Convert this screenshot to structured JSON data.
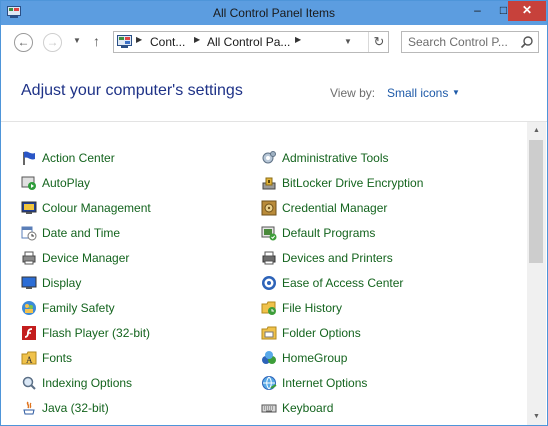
{
  "window": {
    "title": "All Control Panel Items",
    "minimize": "–",
    "maximize": "□",
    "close": "✕"
  },
  "nav": {
    "back": "←",
    "forward": "→",
    "recent": "▼",
    "up": "↑"
  },
  "address": {
    "crumbs": [
      "Cont...",
      "All Control Pa..."
    ],
    "separator": "▶",
    "dropdown": "▼",
    "refresh": "↻"
  },
  "search": {
    "placeholder": "Search Control P..."
  },
  "header": {
    "title": "Adjust your computer's settings",
    "view_by_label": "View by:",
    "view_by_value": "Small icons",
    "view_by_arrow": "▼"
  },
  "items_left": [
    {
      "label": "Action Center",
      "icon": "flag-icon"
    },
    {
      "label": "AutoPlay",
      "icon": "autoplay-icon"
    },
    {
      "label": "Colour Management",
      "icon": "monitor-icon"
    },
    {
      "label": "Date and Time",
      "icon": "calendar-clock-icon"
    },
    {
      "label": "Device Manager",
      "icon": "printer-device-icon"
    },
    {
      "label": "Display",
      "icon": "display-icon"
    },
    {
      "label": "Family Safety",
      "icon": "family-icon"
    },
    {
      "label": "Flash Player (32-bit)",
      "icon": "flash-icon"
    },
    {
      "label": "Fonts",
      "icon": "fonts-folder-icon"
    },
    {
      "label": "Indexing Options",
      "icon": "magnifier-icon"
    },
    {
      "label": "Java (32-bit)",
      "icon": "java-icon"
    }
  ],
  "items_right": [
    {
      "label": "Administrative Tools",
      "icon": "tools-icon"
    },
    {
      "label": "BitLocker Drive Encryption",
      "icon": "bitlocker-icon"
    },
    {
      "label": "Credential Manager",
      "icon": "vault-icon"
    },
    {
      "label": "Default Programs",
      "icon": "default-programs-icon"
    },
    {
      "label": "Devices and Printers",
      "icon": "printer-icon"
    },
    {
      "label": "Ease of Access Center",
      "icon": "ease-access-icon"
    },
    {
      "label": "File History",
      "icon": "file-history-icon"
    },
    {
      "label": "Folder Options",
      "icon": "folder-options-icon"
    },
    {
      "label": "HomeGroup",
      "icon": "homegroup-icon"
    },
    {
      "label": "Internet Options",
      "icon": "internet-icon"
    },
    {
      "label": "Keyboard",
      "icon": "keyboard-icon"
    }
  ],
  "scrollbar": {
    "up": "▲",
    "down": "▼"
  },
  "colors": {
    "titlebar": "#5c9de0",
    "link_green": "#14641e",
    "heading_blue": "#1e3287",
    "close_red": "#c7413b"
  }
}
